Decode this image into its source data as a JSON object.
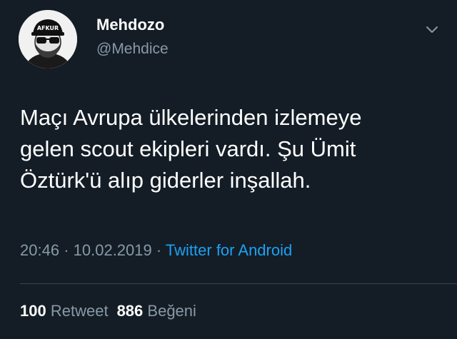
{
  "user": {
    "display_name": "Mehdozo",
    "handle": "@Mehdice",
    "avatar_cap_text": "AFKUR"
  },
  "tweet": {
    "lines": [
      "Maçı Avrupa ülkelerinden izlemeye",
      "gelen scout ekipleri vardı. Şu Ümit",
      "Öztürk'ü alıp giderler inşallah."
    ],
    "time": "20:46",
    "date": "10.02.2019",
    "separator": "·",
    "source": "Twitter for Android"
  },
  "stats": {
    "retweets_count": "100",
    "retweets_label": "Retweet",
    "likes_count": "886",
    "likes_label": "Beğeni"
  },
  "icons": {
    "menu": "chevron-down-icon"
  },
  "colors": {
    "background": "#141d26",
    "secondary_text": "#8899a6",
    "link": "#1da1f2",
    "divider": "#38444d"
  }
}
